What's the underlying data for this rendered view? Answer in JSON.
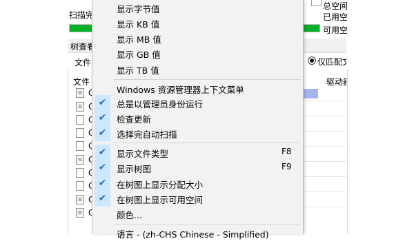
{
  "background": {
    "scan_label": "扫描完",
    "total_space": "总空间",
    "used_space": "已用空",
    "free_space": "可用空",
    "tree_view_tab": "树查看",
    "file_label": "文件",
    "match_only": "仅匹配文",
    "file_column": "文件",
    "drive_column": "驱动器",
    "row_letter": "C"
  },
  "menu": {
    "items": [
      {
        "label": "显示字节值",
        "checked": false
      },
      {
        "label": "显示 KB 值",
        "checked": false
      },
      {
        "label": "显示 MB 值",
        "checked": false
      },
      {
        "label": "显示 GB 值",
        "checked": false
      },
      {
        "label": "显示 TB 值",
        "checked": false
      },
      {
        "label": "Windows 资源管理器上下文菜单",
        "checked": false
      },
      {
        "label": "总是以管理员身份运行",
        "checked": true
      },
      {
        "label": "检查更新",
        "checked": true
      },
      {
        "label": "选择完自动扫描",
        "checked": true
      },
      {
        "label": "显示文件类型",
        "checked": true,
        "shortcut": "F8"
      },
      {
        "label": "显示树图",
        "checked": true,
        "shortcut": "F9"
      },
      {
        "label": "在树图上显示分配大小",
        "checked": true
      },
      {
        "label": "在树图上显示可用空间",
        "checked": true
      },
      {
        "label": "颜色...",
        "checked": false
      },
      {
        "label": "语言 - (zh-CHS Chinese - Simplified)",
        "checked": false
      }
    ],
    "check_glyph": "✔"
  },
  "colors": {
    "progress_green": "#06b025",
    "check_bg": "#cce8ff",
    "menu_bg": "#f2f2f2"
  }
}
